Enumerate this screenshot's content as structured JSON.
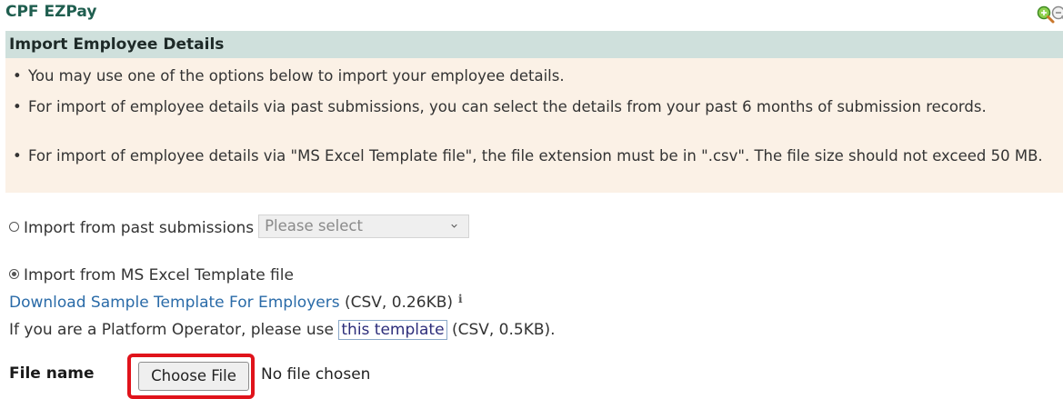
{
  "app": {
    "title": "CPF EZPay"
  },
  "toolbar": {
    "zoom_in_icon": "zoom-in-icon",
    "zoom_out_icon": "zoom-out-icon"
  },
  "section": {
    "title": "Import Employee Details"
  },
  "info": {
    "bullets": [
      "You may use one of the options below to import your employee details.",
      "For import of employee details via past submissions, you can select the details from your past 6 months of submission records.",
      "For import of employee details via \"MS Excel Template file\", the file extension must be in \".csv\". The file size should not exceed 50 MB."
    ]
  },
  "options": {
    "past": {
      "label": "Import from past submissions",
      "selected": false,
      "select_value": "Please select"
    },
    "excel": {
      "label": "Import from MS Excel Template file",
      "selected": true
    }
  },
  "download": {
    "link_text": "Download Sample Template For Employers",
    "meta": "(CSV, 0.26KB)",
    "info_icon": "i"
  },
  "platform": {
    "prefix": "If you are a Platform Operator, please use",
    "link_text": "this template",
    "suffix": "(CSV, 0.5KB)."
  },
  "file": {
    "label": "File name",
    "button_label": "Choose File",
    "status": "No file chosen"
  },
  "colors": {
    "brand": "#1f5e4f",
    "header_bg": "#cfe0dc",
    "info_bg": "#fbf1e6",
    "link": "#2a6ba8",
    "highlight": "#e0131b"
  }
}
